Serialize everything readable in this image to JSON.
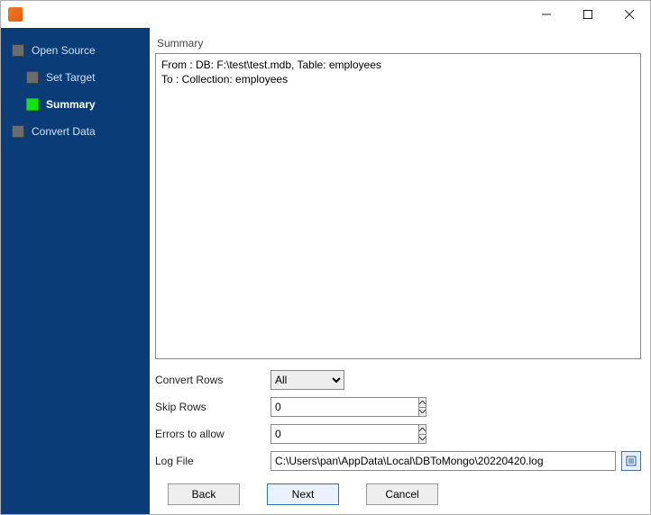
{
  "sidebar": {
    "items": [
      {
        "label": "Open Source"
      },
      {
        "label": "Set Target"
      },
      {
        "label": "Summary"
      },
      {
        "label": "Convert Data"
      }
    ],
    "active_index": 2
  },
  "main": {
    "summary_label": "Summary",
    "summary_lines": [
      "From : DB: F:\\test\\test.mdb, Table: employees",
      "To : Collection: employees"
    ]
  },
  "options": {
    "convert_rows": {
      "label": "Convert Rows",
      "value": "All",
      "options": [
        "All"
      ]
    },
    "skip_rows": {
      "label": "Skip Rows",
      "value": "0"
    },
    "errors_allow": {
      "label": "Errors to allow",
      "value": "0"
    },
    "log_file": {
      "label": "Log File",
      "value": "C:\\Users\\pan\\AppData\\Local\\DBToMongo\\20220420.log"
    }
  },
  "buttons": {
    "back": "Back",
    "next": "Next",
    "cancel": "Cancel"
  }
}
